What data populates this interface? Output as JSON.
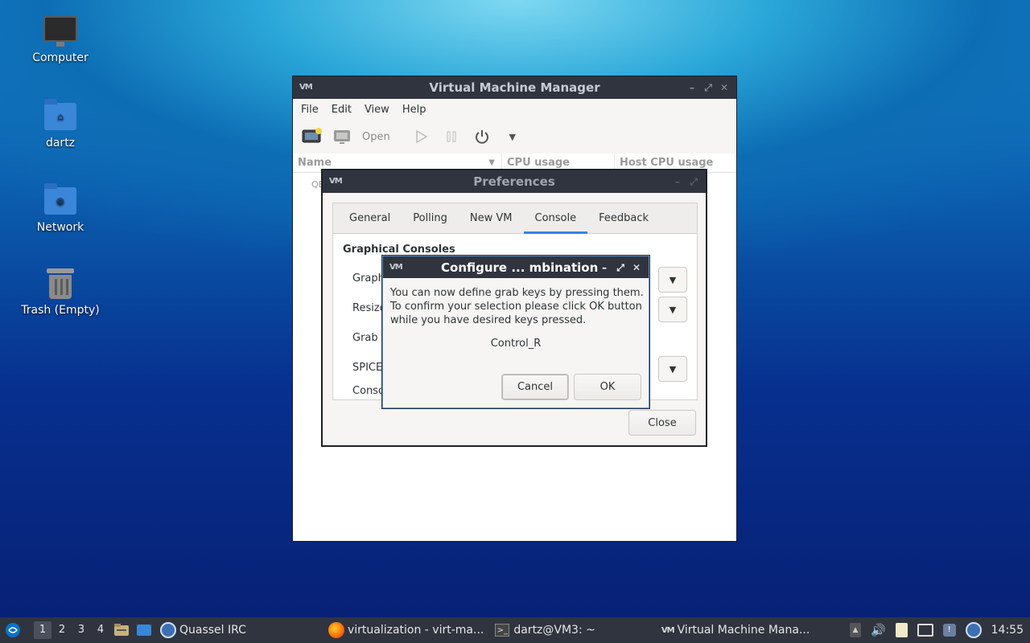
{
  "desktop": {
    "icons": [
      {
        "label": "Computer",
        "icon": "computer-icon"
      },
      {
        "label": "dartz",
        "icon": "home-folder-icon"
      },
      {
        "label": "Network",
        "icon": "network-folder-icon"
      },
      {
        "label": "Trash (Empty)",
        "icon": "trash-icon"
      }
    ]
  },
  "vmm": {
    "title": "Virtual Machine Manager",
    "menu": [
      "File",
      "Edit",
      "View",
      "Help"
    ],
    "toolbar": {
      "open_label": "Open"
    },
    "columns": [
      "Name",
      "CPU usage",
      "Host CPU usage"
    ],
    "row_fragment": "QE"
  },
  "prefs": {
    "title": "Preferences",
    "tabs": [
      "General",
      "Polling",
      "New VM",
      "Console",
      "Feedback"
    ],
    "active_tab": "Console",
    "section": "Graphical Consoles",
    "rows": [
      "Graph",
      "Resize",
      "Grab k",
      "SPICE",
      "Consol"
    ],
    "close_label": "Close"
  },
  "configure": {
    "title": "Configure ... mbination",
    "message_lines": [
      "You can now define grab keys by pressing them.",
      "To confirm your selection please click OK button",
      "while you have desired keys pressed."
    ],
    "key": "Control_R",
    "cancel_label": "Cancel",
    "ok_label": "OK"
  },
  "taskbar": {
    "workspaces": [
      "1",
      "2",
      "3",
      "4"
    ],
    "apps": [
      {
        "label": "Quassel IRC"
      },
      {
        "label": "virtualization - virt-ma..."
      },
      {
        "label": "dartz@VM3: ~"
      },
      {
        "label": "Virtual Machine Mana..."
      }
    ],
    "clock": "14:55"
  },
  "colors": {
    "titlebar": "#2f343f",
    "accent": "#3584e4",
    "dialog_border": "#5a8fd0"
  }
}
